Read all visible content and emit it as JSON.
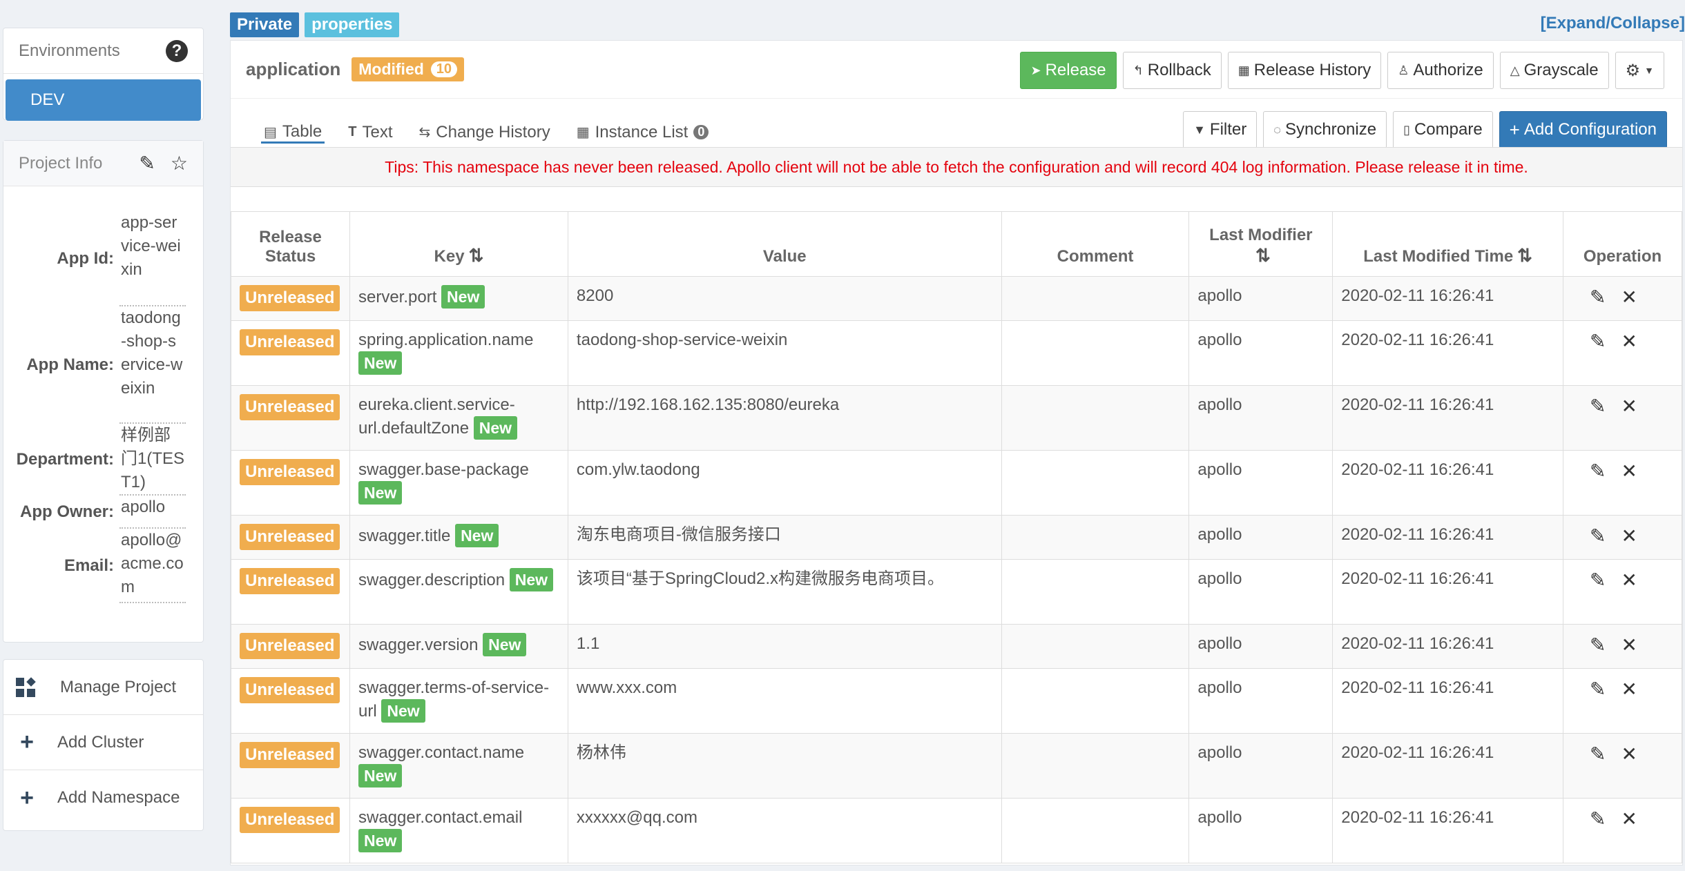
{
  "sidebar": {
    "environments_title": "Environments",
    "env_items": [
      "DEV"
    ],
    "project_info_title": "Project Info",
    "info": [
      {
        "label": "App Id:",
        "value": "app-service-weixin"
      },
      {
        "label": "App Name:",
        "value": "taodong-shop-service-weixin"
      },
      {
        "label": "Department:",
        "value": "样例部门1(TEST1)"
      },
      {
        "label": "App Owner:",
        "value": "apollo"
      },
      {
        "label": "Email:",
        "value": "apollo@acme.com"
      }
    ],
    "actions": [
      "Manage Project",
      "Add Cluster",
      "Add Namespace"
    ]
  },
  "labels": {
    "private": "Private",
    "format": "properties",
    "expand": "[Expand/Collapse]"
  },
  "namespace": {
    "name": "application",
    "modified_label": "Modified",
    "modified_count": "10",
    "buttons": {
      "release": "Release",
      "rollback": "Rollback",
      "history": "Release History",
      "authorize": "Authorize",
      "grayscale": "Grayscale"
    }
  },
  "tabs": {
    "table": "Table",
    "text": "Text",
    "change_history": "Change History",
    "instance_list": "Instance List",
    "instance_count": "0"
  },
  "tools": {
    "filter": "Filter",
    "synchronize": "Synchronize",
    "compare": "Compare",
    "add_config": "Add Configuration"
  },
  "tips": "Tips: This namespace has never been released. Apollo client will not be able to fetch the configuration and will record 404 log information. Please release it in time.",
  "table": {
    "headers": {
      "status": "Release Status",
      "key": "Key",
      "value": "Value",
      "comment": "Comment",
      "modifier": "Last Modifier",
      "time": "Last Modified Time",
      "operation": "Operation"
    },
    "status_label": "Unreleased",
    "new_label": "New",
    "rows": [
      {
        "key": "server.port",
        "value": "8200",
        "comment": "",
        "modifier": "apollo",
        "time": "2020-02-11 16:26:41"
      },
      {
        "key": "spring.application.name",
        "value": "taodong-shop-service-weixin",
        "comment": "",
        "modifier": "apollo",
        "time": "2020-02-11 16:26:41"
      },
      {
        "key": "eureka.client.service-url.defaultZone",
        "value": "http://192.168.162.135:8080/eureka",
        "comment": "",
        "modifier": "apollo",
        "time": "2020-02-11 16:26:41"
      },
      {
        "key": "swagger.base-package",
        "value": "com.ylw.taodong",
        "comment": "",
        "modifier": "apollo",
        "time": "2020-02-11 16:26:41"
      },
      {
        "key": "swagger.title",
        "value": "淘东电商项目-微信服务接口",
        "comment": "",
        "modifier": "apollo",
        "time": "2020-02-11 16:26:41"
      },
      {
        "key": "swagger.description",
        "value": "该项目“基于SpringCloud2.x构建微服务电商项目。",
        "comment": "",
        "modifier": "apollo",
        "time": "2020-02-11 16:26:41"
      },
      {
        "key": "swagger.version",
        "value": "1.1",
        "comment": "",
        "modifier": "apollo",
        "time": "2020-02-11 16:26:41"
      },
      {
        "key": "swagger.terms-of-service-url",
        "value": "www.xxx.com",
        "comment": "",
        "modifier": "apollo",
        "time": "2020-02-11 16:26:41"
      },
      {
        "key": "swagger.contact.name",
        "value": "杨林伟",
        "comment": "",
        "modifier": "apollo",
        "time": "2020-02-11 16:26:41"
      },
      {
        "key": "swagger.contact.email",
        "value": "xxxxxx@qq.com",
        "comment": "",
        "modifier": "apollo",
        "time": "2020-02-11 16:26:41"
      }
    ]
  }
}
